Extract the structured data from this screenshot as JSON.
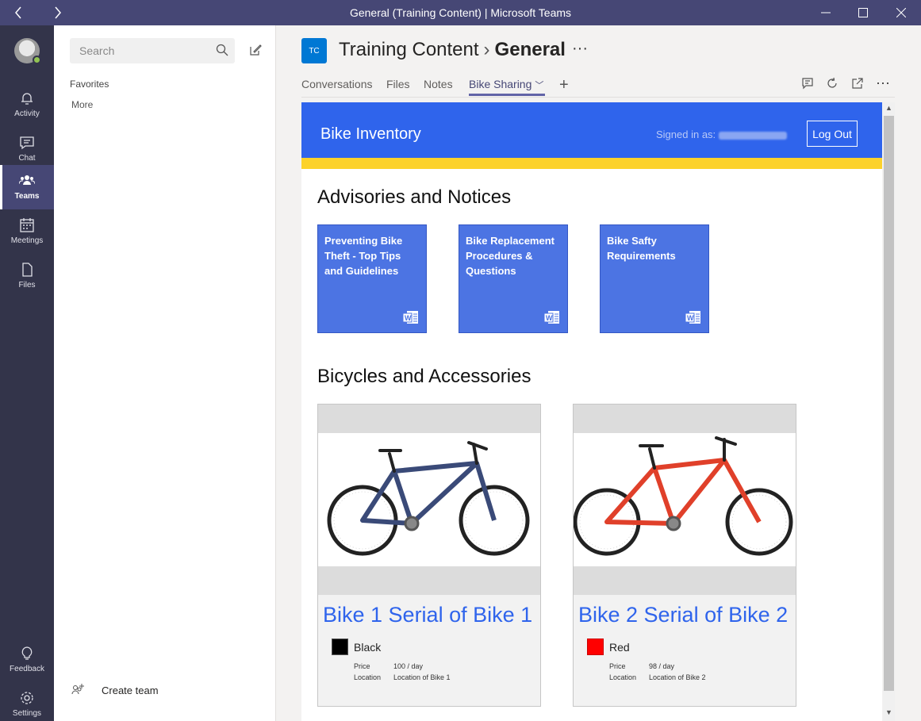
{
  "window": {
    "title": "General (Training Content) | Microsoft Teams"
  },
  "rail": {
    "items": [
      {
        "label": "Activity",
        "icon": "bell-icon"
      },
      {
        "label": "Chat",
        "icon": "chat-icon"
      },
      {
        "label": "Teams",
        "icon": "teams-icon"
      },
      {
        "label": "Meetings",
        "icon": "calendar-icon"
      },
      {
        "label": "Files",
        "icon": "file-icon"
      }
    ],
    "bottom": [
      {
        "label": "Feedback",
        "icon": "lightbulb-icon"
      },
      {
        "label": "Settings",
        "icon": "gear-icon"
      }
    ]
  },
  "panel": {
    "search_placeholder": "Search",
    "favorites": "Favorites",
    "more": "More",
    "create_team": "Create team"
  },
  "header": {
    "badge": "TC",
    "team": "Training Content",
    "channel": "General",
    "more": "···",
    "tabs": [
      "Conversations",
      "Files",
      "Notes",
      "Bike Sharing"
    ],
    "active_tab": "Bike Sharing"
  },
  "app": {
    "name": "Bike Inventory",
    "signed_in_label": "Signed in as:",
    "logout": "Log Out",
    "advisories_title": "Advisories and Notices",
    "advisories": [
      "Preventing Bike Theft - Top Tips and Guidelines",
      "Bike Replacement Procedures & Questions",
      "Bike Safty Requirements"
    ],
    "bikes_title": "Bicycles and Accessories",
    "bikes": [
      {
        "title": "Bike 1 Serial of Bike 1",
        "color_name": "Black",
        "color": "#000000",
        "frame_color": "#3a4a78",
        "price_label": "Price",
        "price": "100 / day",
        "location_label": "Location",
        "location": "Location of Bike 1"
      },
      {
        "title": "Bike 2 Serial of Bike 2",
        "color_name": "Red",
        "color": "#ff0000",
        "frame_color": "#e0402a",
        "price_label": "Price",
        "price": "98 / day",
        "location_label": "Location",
        "location": "Location of Bike 2"
      }
    ]
  },
  "colors": {
    "rail": "#33344a",
    "titlebar": "#464775",
    "accent": "#6264a7",
    "app_blue": "#2f64ec",
    "app_yellow": "#fcd22b"
  }
}
